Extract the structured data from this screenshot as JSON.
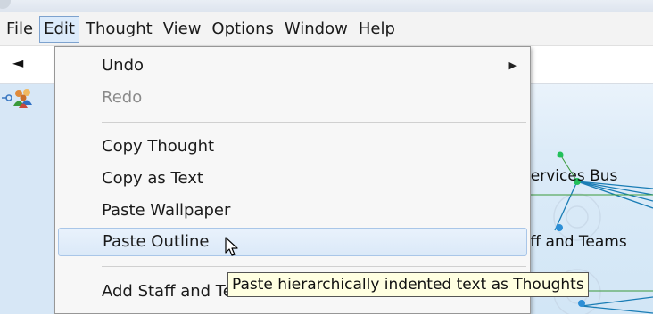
{
  "menubar": {
    "items": [
      "File",
      "Edit",
      "Thought",
      "View",
      "Options",
      "Window",
      "Help"
    ],
    "active_index": 1
  },
  "toolbar": {
    "back_glyph": "◄"
  },
  "plex": {
    "labels": [
      "Services Bus",
      "aff and Teams"
    ],
    "accent_colors": {
      "node": "#22c05a",
      "line": "#1a7db5",
      "highlight": "#3a9a3a"
    }
  },
  "edit_menu": {
    "items": [
      {
        "label": "Undo",
        "disabled": false,
        "has_submenu": true
      },
      {
        "label": "Redo",
        "disabled": true
      },
      {
        "label": "Copy Thought",
        "disabled": false
      },
      {
        "label": "Copy as Text",
        "disabled": false
      },
      {
        "label": "Paste Wallpaper",
        "disabled": false
      },
      {
        "label": "Paste Outline",
        "disabled": false,
        "hovered": true
      },
      {
        "label": "Add Staff and Teams to Selection",
        "disabled": false
      }
    ]
  },
  "tooltip": {
    "text": "Paste hierarchically indented text as Thoughts"
  },
  "icons": [
    "back-arrow-icon",
    "people-icon",
    "link-icon",
    "submenu-arrow-icon",
    "pointer-cursor-icon"
  ]
}
